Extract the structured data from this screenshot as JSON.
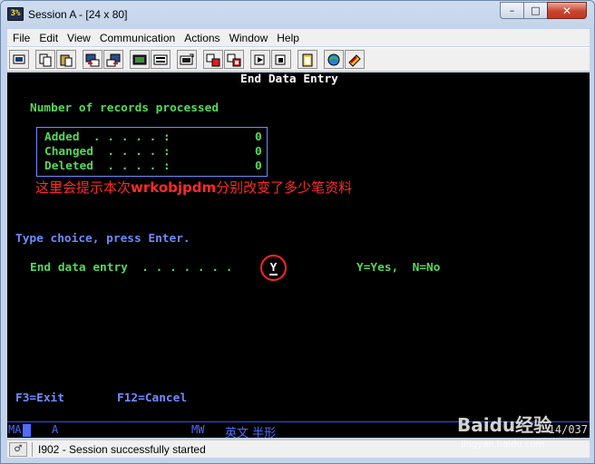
{
  "window": {
    "title": "Session A - [24 x 80]",
    "app_icon_text": "3%",
    "buttons": {
      "minimize": "–",
      "maximize": "□",
      "close": "✕"
    }
  },
  "menubar": {
    "items": [
      "File",
      "Edit",
      "View",
      "Communication",
      "Actions",
      "Window",
      "Help"
    ]
  },
  "toolbar": {
    "icons": [
      "print-screen-icon",
      "copy-icon",
      "paste-icon",
      "send-file-icon",
      "receive-file-icon",
      "display-keypad-icon",
      "record-macro-icon",
      "customize-icon",
      "playback-icon",
      "stop-icon",
      "run-macro-icon",
      "macro-stop-icon",
      "clipboard-icon",
      "connect-icon",
      "disconnect-icon"
    ]
  },
  "terminal": {
    "title": "End Data Entry",
    "records_heading": "Number of records processed",
    "records": [
      {
        "label": "Added  . . . . . :",
        "value": "0"
      },
      {
        "label": "Changed  . . . . :",
        "value": "0"
      },
      {
        "label": "Deleted  . . . . :",
        "value": "0"
      }
    ],
    "annotation_prefix": "这里会提示本次",
    "annotation_bold": "wrkobjpdm",
    "annotation_suffix": "分别改变了多少笔资料",
    "instruction": "Type choice, press Enter.",
    "prompt_label": "End data entry  . . . . . . .",
    "prompt_value": "Y",
    "prompt_hint": "Y=Yes,  N=No",
    "function_keys": [
      "F3=Exit",
      "F12=Cancel"
    ],
    "colors": {
      "green": "#56d85a",
      "white": "#ffffff",
      "blue": "#6d8cff",
      "annotation": "#ff2a2a"
    }
  },
  "oia": {
    "mode": "MA",
    "a": "A",
    "mw": "MW",
    "ime": "英文 半形",
    "cursor_pos": "14/037"
  },
  "statusbar": {
    "icon": "♂",
    "message": "I902 - Session successfully started"
  },
  "watermark": {
    "text": "Baidu经验",
    "sub": "jingyan.baidu.com"
  }
}
